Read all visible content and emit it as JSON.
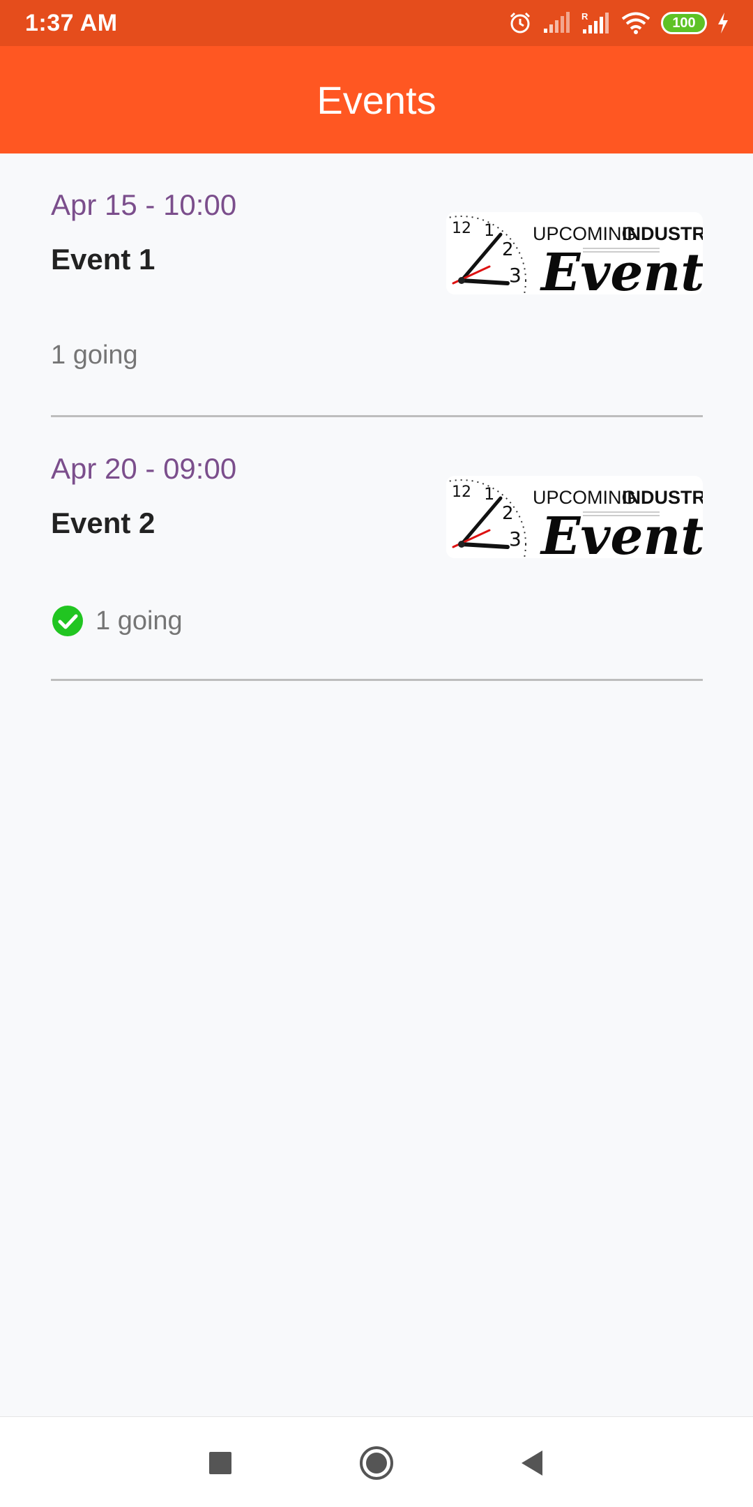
{
  "status_bar": {
    "time": "1:37 AM",
    "battery_level": "100",
    "icons": [
      "alarm-icon",
      "signal-icon",
      "signal-roaming-icon",
      "wifi-icon",
      "battery-icon",
      "charging-icon"
    ]
  },
  "app_bar": {
    "title": "Events"
  },
  "events": [
    {
      "date": "Apr 15 - 10:00",
      "name": "Event 1",
      "going": "1 going",
      "attending": false,
      "image": {
        "line1_a": "UPCOMING",
        "line1_b": "INDUSTRY",
        "line2": "Events",
        "clock_numbers": [
          "12",
          "1",
          "2",
          "3"
        ]
      }
    },
    {
      "date": "Apr 20 - 09:00",
      "name": "Event 2",
      "going": "1 going",
      "attending": true,
      "image": {
        "line1_a": "UPCOMING",
        "line1_b": "INDUSTRY",
        "line2": "Events",
        "clock_numbers": [
          "12",
          "1",
          "2",
          "3"
        ]
      }
    }
  ],
  "nav_bar": {
    "buttons": [
      "recents-button",
      "home-button",
      "back-button"
    ]
  },
  "colors": {
    "status_bar": "#e54d1c",
    "app_bar": "#ff5722",
    "date_text": "#7b4e8c",
    "check": "#21c521"
  }
}
